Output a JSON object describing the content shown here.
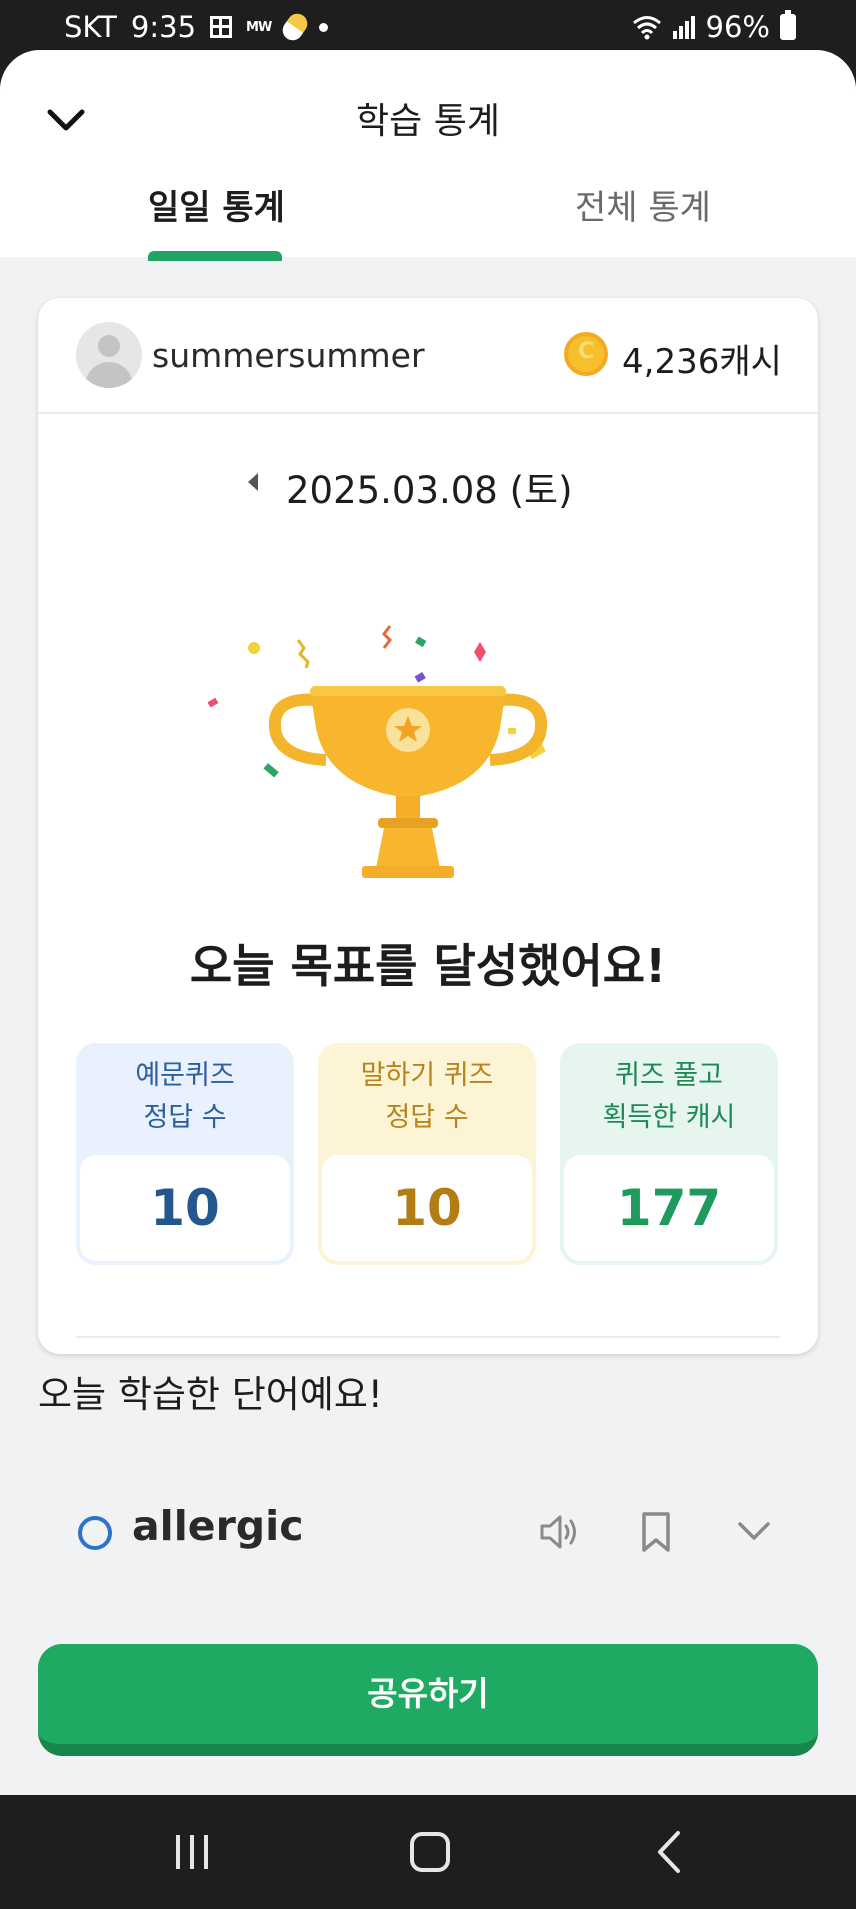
{
  "status_bar": {
    "carrier": "SKT",
    "time": "9:35",
    "mw_label": "MW",
    "battery": "96%"
  },
  "header": {
    "title": "학습 통계",
    "tabs": [
      {
        "label": "일일 통계",
        "active": true
      },
      {
        "label": "전체 통계",
        "active": false
      }
    ],
    "accent_color": "#1fa463"
  },
  "user": {
    "name": "summersummer",
    "cash": "4,236캐시"
  },
  "date": {
    "text": "2025.03.08 (토)"
  },
  "achievement": {
    "message": "오늘 목표를 달성했어요!"
  },
  "stats": [
    {
      "label_line1": "예문퀴즈",
      "label_line2": "정답 수",
      "value": "10",
      "color": "#24578e"
    },
    {
      "label_line1": "말하기 퀴즈",
      "label_line2": "정답 수",
      "value": "10",
      "color": "#b27d14"
    },
    {
      "label_line1": "퀴즈 풀고",
      "label_line2": "획득한 캐시",
      "value": "177",
      "color": "#1d9a5c"
    }
  ],
  "learned": {
    "title": "오늘 학습한 단어예요!",
    "words": [
      {
        "word": "allergic"
      }
    ]
  },
  "share_button": {
    "label": "공유하기",
    "color": "#1faa63"
  },
  "icons": {
    "back": "chevron-down-icon",
    "coin": "coin-icon",
    "speaker": "speaker-icon",
    "bookmark": "bookmark-icon",
    "expand": "chevron-down-icon"
  }
}
